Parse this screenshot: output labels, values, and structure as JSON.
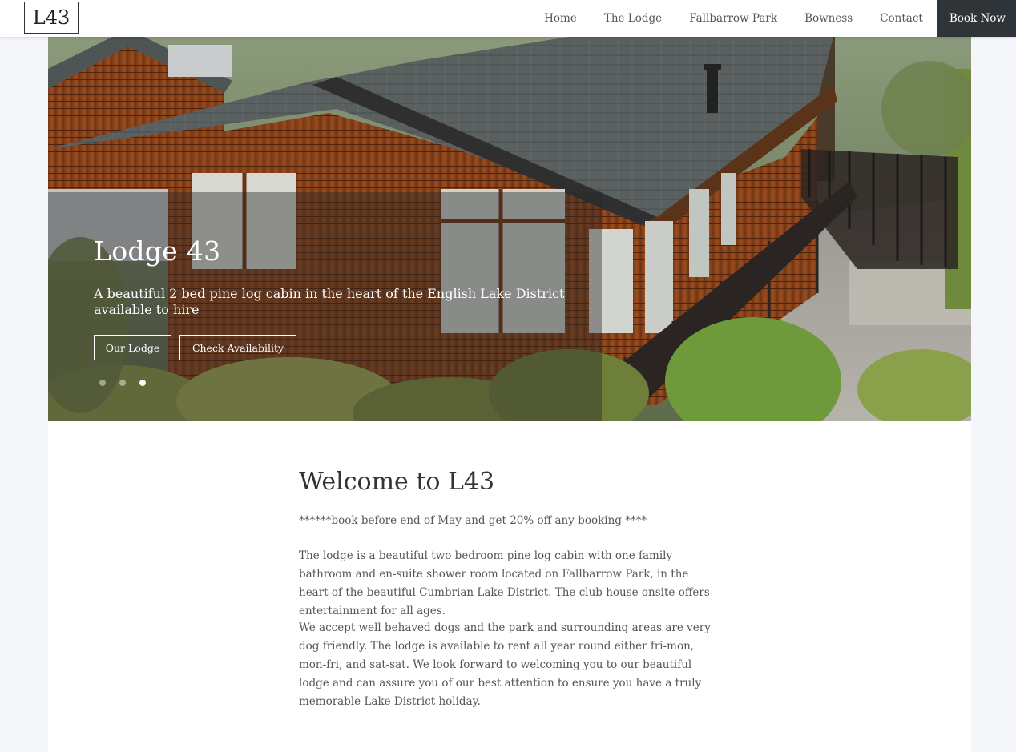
{
  "header": {
    "logo": "L43",
    "nav": [
      {
        "label": "Home"
      },
      {
        "label": "The Lodge"
      },
      {
        "label": "Fallbarrow Park"
      },
      {
        "label": "Bowness"
      },
      {
        "label": "Contact"
      }
    ],
    "book_now": "Book Now"
  },
  "hero": {
    "title": "Lodge 43",
    "subtitle": "A beautiful 2 bed pine log cabin in the heart of the English Lake District available to hire",
    "buttons": {
      "our_lodge": "Our Lodge",
      "check_availability": "Check Availability"
    },
    "slides": 3,
    "active_slide": 3
  },
  "content": {
    "heading": "Welcome to L43",
    "promo": "******book before end of May and get 20% off any booking ****",
    "paragraph1": "The lodge is a beautiful two bedroom pine log cabin with one family bathroom and en-suite shower room located on Fallbarrow Park, in the heart of the beautiful Cumbrian Lake District. The club house onsite offers entertainment for all ages.",
    "paragraph2": "We accept well behaved dogs and the park and surrounding areas are very dog friendly. The lodge is available to rent all year round either fri-mon, mon-fri, and sat-sat. We look forward to welcoming you to our beautiful lodge and can assure you of our best attention to ensure you have a truly memorable Lake District holiday."
  },
  "colors": {
    "book_now_bg": "#2e3438",
    "page_bg": "#f5f6fa"
  }
}
